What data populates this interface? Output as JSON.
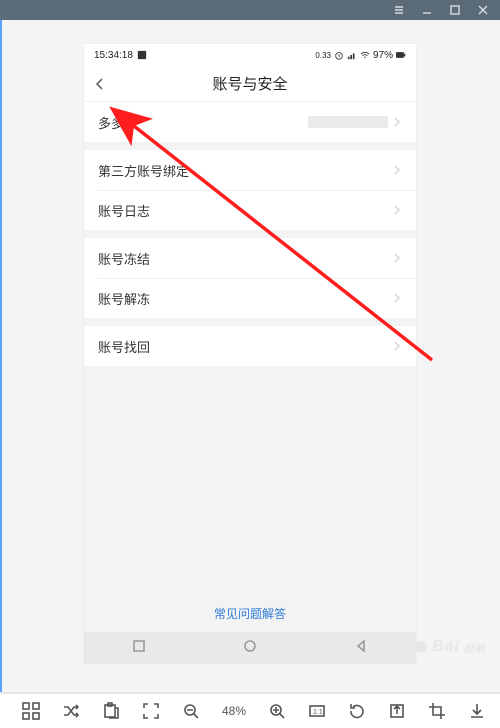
{
  "phone": {
    "statusbar": {
      "time": "15:34:18",
      "battery": "97%",
      "net_kb": "0.33"
    },
    "header": {
      "title": "账号与安全"
    },
    "rows": {
      "r0": "多多号",
      "r1": "第三方账号绑定",
      "r2": "账号日志",
      "r3": "账号冻结",
      "r4": "账号解冻",
      "r5": "账号找回"
    },
    "faq": "常见问题解答"
  },
  "toolbar": {
    "zoom": "48%"
  },
  "watermark": {
    "brand": "Bai",
    "sub": "经验"
  }
}
